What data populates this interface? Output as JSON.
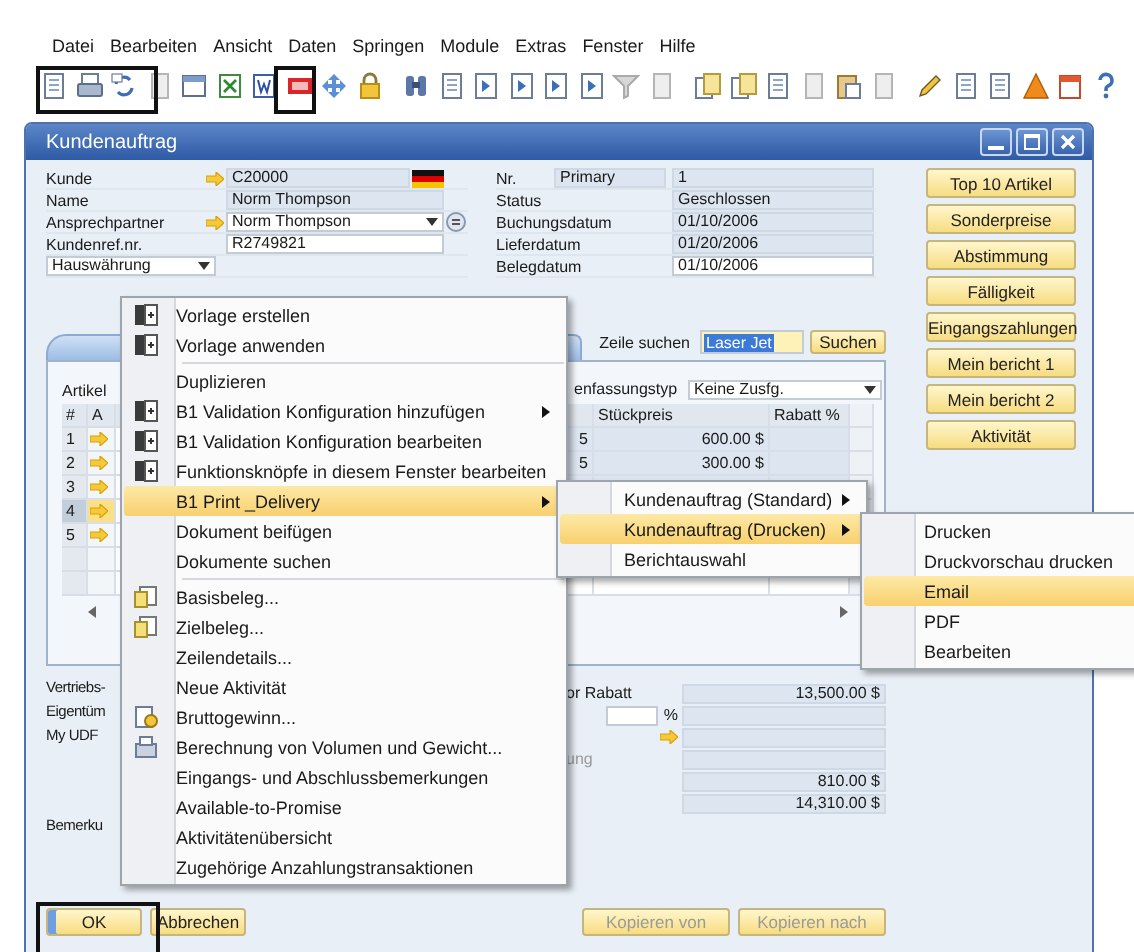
{
  "menubar": [
    {
      "label": "Datei"
    },
    {
      "label": "Bearbeiten"
    },
    {
      "label": "Ansicht"
    },
    {
      "label": "Daten"
    },
    {
      "label": "Springen"
    },
    {
      "label": "Module"
    },
    {
      "label": "Extras"
    },
    {
      "label": "Fenster"
    },
    {
      "label": "Hilfe"
    }
  ],
  "window": {
    "title": "Kundenauftrag"
  },
  "header_left": [
    {
      "kind": "link_flag",
      "label": "Kunde",
      "value": "C20000",
      "editable": false
    },
    {
      "kind": "field",
      "label": "Name",
      "value": "Norm Thompson",
      "editable": false
    },
    {
      "kind": "link_select",
      "label": "Ansprechpartner",
      "value": "Norm Thompson",
      "editable": true
    },
    {
      "kind": "field",
      "label": "Kundenref.nr.",
      "value": "R2749821",
      "editable": true
    },
    {
      "kind": "select",
      "value": "Hauswährung",
      "editable": true
    }
  ],
  "header_right": [
    {
      "label": "Nr.",
      "series": "Primary",
      "value": "1",
      "editable": false
    },
    {
      "label": "Status",
      "value": "Geschlossen",
      "editable": false
    },
    {
      "label": "Buchungsdatum",
      "value": "01/10/2006",
      "editable": false
    },
    {
      "label": "Lieferdatum",
      "value": "01/20/2006",
      "editable": false
    },
    {
      "label": "Belegdatum",
      "value": "01/10/2006",
      "editable": true
    }
  ],
  "side_buttons": [
    "Top 10 Artikel",
    "Sonderpreise",
    "Abstimmung",
    "Fälligkeit",
    "Eingangszahlungen",
    "Mein bericht 1",
    "Mein bericht 2",
    "Aktivität"
  ],
  "row_search": {
    "label": "Zeile suchen",
    "value": "Laser Jet",
    "button": "Suchen"
  },
  "items_panel": {
    "label": "Artikel",
    "summary_label": "enfassungstyp",
    "summary_value": "Keine Zusfg.",
    "columns": {
      "number": "#",
      "column_2": "A",
      "price": "Stückpreis",
      "discount": "Rabatt %"
    },
    "rows": [
      {
        "kind": "item",
        "number": "1",
        "column_3": "5",
        "price": "600.00 $",
        "selected": false
      },
      {
        "kind": "item",
        "number": "2",
        "column_3": "5",
        "price": "300.00 $",
        "selected": false
      },
      {
        "kind": "item",
        "number": "3",
        "selected": false
      },
      {
        "kind": "item",
        "number": "4",
        "selected": true
      },
      {
        "kind": "item",
        "number": "5",
        "selected": false
      },
      {
        "kind": "empty",
        "selected": false
      },
      {
        "kind": "empty",
        "selected": false
      }
    ]
  },
  "summary": {
    "labels": [
      "Vertriebs-",
      "Eigentüm",
      "My UDF"
    ],
    "remarks_label": "Bemerku",
    "totals": [
      {
        "kind": "amount",
        "label": "or Rabatt",
        "value": "13,500.00 $"
      },
      {
        "kind": "percent",
        "unit": "%"
      },
      {
        "kind": "link"
      },
      {
        "kind": "amount",
        "label": "ung",
        "disabled": true
      },
      {
        "kind": "amount",
        "value": "810.00 $"
      },
      {
        "kind": "amount",
        "value": "14,310.00 $"
      }
    ]
  },
  "footer": {
    "buttons": [
      {
        "label": "OK",
        "disabled": false
      },
      {
        "label": "Abbrechen",
        "disabled": false
      }
    ],
    "copy_buttons": [
      {
        "label": "Kopieren von",
        "disabled": true
      },
      {
        "label": "Kopieren nach",
        "disabled": true
      }
    ]
  },
  "context_menu": [
    {
      "kind": "template",
      "label": "Vorlage erstellen",
      "submenu": false,
      "highlighted": false
    },
    {
      "kind": "template",
      "label": "Vorlage anwenden",
      "submenu": false,
      "highlighted": false
    },
    {
      "kind": "separator"
    },
    {
      "kind": "plain",
      "label": "Duplizieren",
      "submenu": false,
      "highlighted": false
    },
    {
      "kind": "template",
      "label": "B1 Validation Konfiguration hinzufügen",
      "submenu": true,
      "highlighted": false
    },
    {
      "kind": "template",
      "label": "B1 Validation Konfiguration bearbeiten",
      "submenu": false,
      "highlighted": false
    },
    {
      "kind": "template",
      "label": "Funktionsknöpfe in diesem Fenster bearbeiten",
      "submenu": false,
      "highlighted": false
    },
    {
      "kind": "plain",
      "label": "B1 Print _Delivery",
      "submenu": true,
      "highlighted": true
    },
    {
      "kind": "plain",
      "label": "Dokument beifügen",
      "submenu": false,
      "highlighted": false
    },
    {
      "kind": "plain",
      "label": "Dokumente suchen",
      "submenu": false,
      "highlighted": false
    },
    {
      "kind": "separator"
    },
    {
      "kind": "document",
      "label": "Basisbeleg...",
      "submenu": false,
      "highlighted": false
    },
    {
      "kind": "document",
      "label": "Zielbeleg...",
      "submenu": false,
      "highlighted": false
    },
    {
      "kind": "plain",
      "label": "Zeilendetails...",
      "submenu": false,
      "highlighted": false
    },
    {
      "kind": "plain",
      "label": "Neue Aktivität",
      "submenu": false,
      "highlighted": false
    },
    {
      "kind": "gross",
      "label": "Bruttogewinn...",
      "submenu": false,
      "highlighted": false
    },
    {
      "kind": "weight",
      "label": "Berechnung von Volumen und Gewicht...",
      "submenu": false,
      "highlighted": false
    },
    {
      "kind": "plain",
      "label": "Eingangs- und Abschlussbemerkungen",
      "submenu": false,
      "highlighted": false
    },
    {
      "kind": "plain",
      "label": "Available-to-Promise",
      "submenu": false,
      "highlighted": false
    },
    {
      "kind": "plain",
      "label": "Aktivitätenübersicht",
      "submenu": false,
      "highlighted": false
    },
    {
      "kind": "plain",
      "label": "Zugehörige Anzahlungstransaktionen",
      "submenu": false,
      "highlighted": false
    }
  ],
  "submenu": [
    {
      "label": "Kundenauftrag (Standard)",
      "submenu": true,
      "highlighted": false
    },
    {
      "label": "Kundenauftrag (Drucken)",
      "submenu": true,
      "highlighted": true
    },
    {
      "label": "Berichtauswahl",
      "submenu": false,
      "highlighted": false
    }
  ],
  "submenu_2": [
    {
      "label": "Drucken",
      "highlighted": false
    },
    {
      "label": "Druckvorschau drucken",
      "highlighted": false
    },
    {
      "label": "Email",
      "highlighted": true
    },
    {
      "label": "PDF",
      "highlighted": false
    },
    {
      "label": "Bearbeiten",
      "highlighted": false
    }
  ]
}
